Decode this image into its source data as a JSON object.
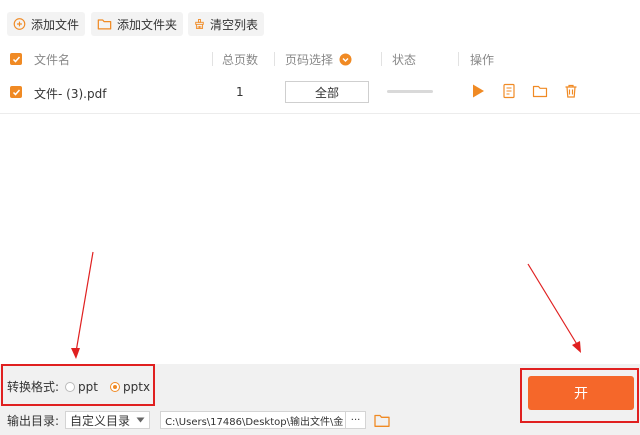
{
  "toolbar": {
    "add_file": "添加文件",
    "add_folder": "添加文件夹",
    "clear_list": "清空列表"
  },
  "table": {
    "headers": {
      "file_name": "文件名",
      "total_pages": "总页数",
      "page_select": "页码选择",
      "status": "状态",
      "actions": "操作"
    },
    "rows": [
      {
        "file_name": "文件- (3).pdf",
        "total_pages": "1",
        "page_select": "全部"
      }
    ]
  },
  "format": {
    "label": "转换格式:",
    "options": [
      "ppt",
      "pptx"
    ],
    "selected": "pptx"
  },
  "output": {
    "label": "输出目录:",
    "dir_mode": "自定义目录",
    "path": "C:\\Users\\17486\\Desktop\\输出文件\\金",
    "more": "···"
  },
  "start_button": {
    "label": "开"
  },
  "colors": {
    "accent": "#f08a24",
    "start_button": "#f5672a",
    "highlight": "#e02020"
  },
  "icons": [
    "plus-circle-icon",
    "folder-icon",
    "broom-icon",
    "play-icon",
    "document-icon",
    "folder-icon",
    "trash-icon",
    "chevron-down-icon"
  ]
}
